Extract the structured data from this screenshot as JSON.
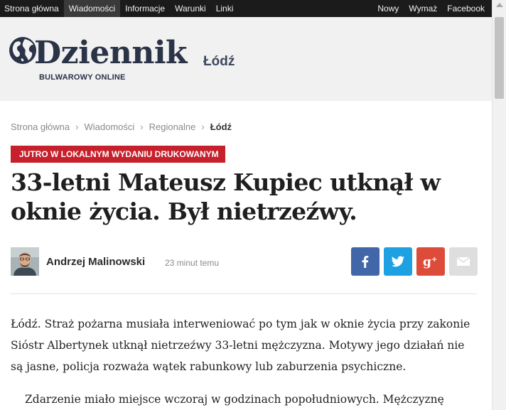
{
  "topnav": {
    "left": [
      {
        "label": "Strona główna",
        "active": false
      },
      {
        "label": "Wiadomości",
        "active": true
      },
      {
        "label": "Informacje",
        "active": false
      },
      {
        "label": "Warunki",
        "active": false
      },
      {
        "label": "Linki",
        "active": false
      }
    ],
    "right": [
      {
        "label": "Nowy"
      },
      {
        "label": "Wymaż"
      },
      {
        "label": "Facebook"
      }
    ]
  },
  "logo": {
    "title": "Dziennik",
    "city": "Łódź",
    "tagline": "BULWAROWY ONLINE",
    "icon": "globe-icon"
  },
  "breadcrumb": [
    "Strona główna",
    "Wiadomości",
    "Regionalne",
    "Łódź"
  ],
  "breadcrumb_separator": "›",
  "article": {
    "label": "JUTRO W LOKALNYM WYDANIU DRUKOWANYM",
    "headline": "33-letni Mateusz Kupiec utknął w oknie życia. Był nietrzeźwy.",
    "author": "Andrzej Malinowski",
    "time": "23 minut temu",
    "lead": "Łódź. Straż pożarna musiała interweniować po tym jak w oknie życia przy zakonie Sióstr Albertynek utknął nietrzeźwy 33-letni mężczyzna. Motywy jego działań nie są jasne, policja rozważa wątek rabunkowy lub zaburzenia psychiczne.",
    "paragraph": "Zdarzenie miało miejsce wczoraj w godzinach popołudniowych. Mężczyznę"
  },
  "share": [
    {
      "name": "facebook-share-button",
      "icon": "facebook-icon",
      "color": "#4267a8"
    },
    {
      "name": "twitter-share-button",
      "icon": "twitter-icon",
      "color": "#1da1e2"
    },
    {
      "name": "google-plus-share-button",
      "icon": "google-plus-icon",
      "color": "#dd4b39"
    },
    {
      "name": "email-share-button",
      "icon": "email-icon",
      "color": "#dedede"
    }
  ],
  "colors": {
    "nav_bg": "#1b1b1b",
    "header_bg": "#f1f1f1",
    "brand": "#2b3347",
    "label_red": "#c5202b"
  }
}
